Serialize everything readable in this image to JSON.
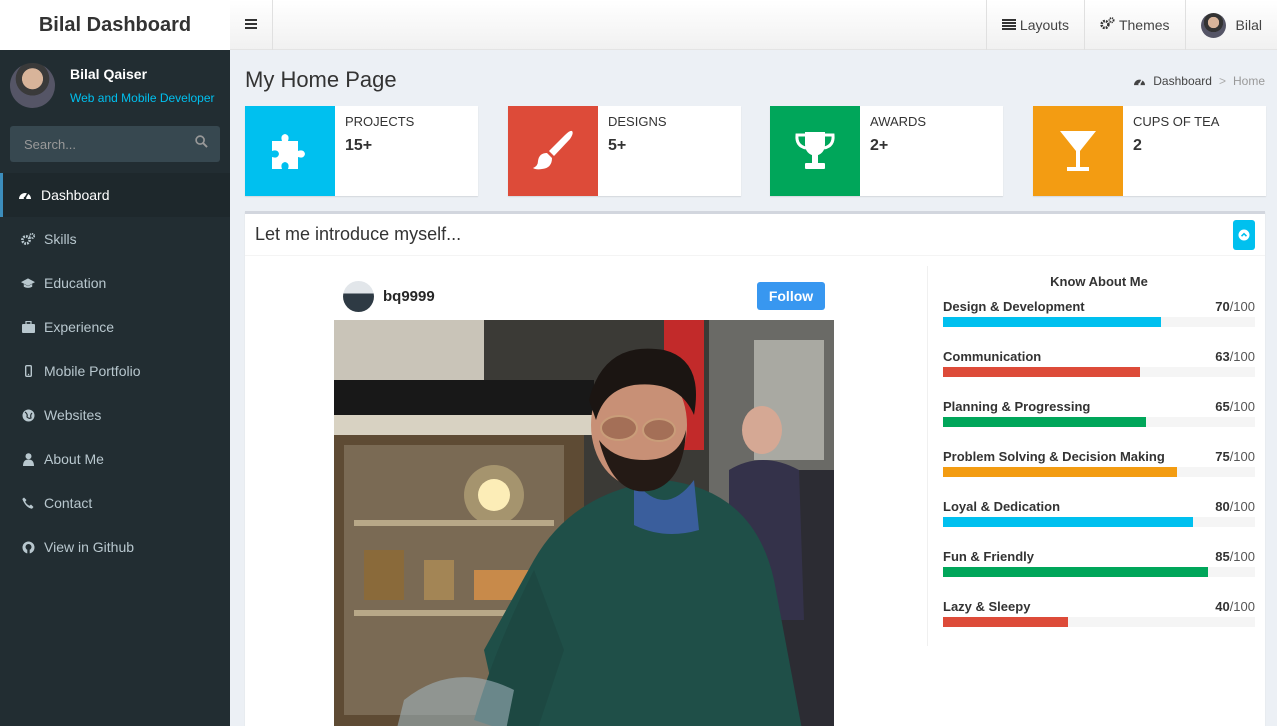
{
  "app": {
    "title": "Bilal Dashboard"
  },
  "user": {
    "name": "Bilal Qaiser",
    "role": "Web and Mobile Developer",
    "short_name": "Bilal"
  },
  "search": {
    "placeholder": "Search..."
  },
  "menu": [
    {
      "label": "Dashboard",
      "icon": "dashboard-icon",
      "active": true
    },
    {
      "label": "Skills",
      "icon": "cogs-icon"
    },
    {
      "label": "Education",
      "icon": "graduation-cap-icon"
    },
    {
      "label": "Experience",
      "icon": "briefcase-icon"
    },
    {
      "label": "Mobile Portfolio",
      "icon": "mobile-icon"
    },
    {
      "label": "Websites",
      "icon": "globe-icon"
    },
    {
      "label": "About Me",
      "icon": "user-icon"
    },
    {
      "label": "Contact",
      "icon": "phone-icon"
    },
    {
      "label": "View in Github",
      "icon": "github-icon"
    }
  ],
  "navbar": {
    "layouts": "Layouts",
    "themes": "Themes"
  },
  "page": {
    "title": "My Home Page"
  },
  "breadcrumb": {
    "home_link": "Dashboard",
    "current": "Home"
  },
  "info_boxes": [
    {
      "label": "PROJECTS",
      "value": "15+",
      "color": "#00c0ef",
      "icon": "puzzle-icon"
    },
    {
      "label": "DESIGNS",
      "value": "5+",
      "color": "#dd4b39",
      "icon": "paint-brush-icon"
    },
    {
      "label": "AWARDS",
      "value": "2+",
      "color": "#00a65a",
      "icon": "trophy-icon"
    },
    {
      "label": "CUPS OF TEA",
      "value": "2",
      "color": "#f39c12",
      "icon": "glass-icon"
    }
  ],
  "intro": {
    "title": "Let me introduce myself..."
  },
  "instagram": {
    "username": "bq9999",
    "follow_label": "Follow"
  },
  "skills": {
    "title": "Know About Me",
    "max_label": "/100",
    "items": [
      {
        "name": "Design & Development",
        "value": 70,
        "color": "#00c0ef"
      },
      {
        "name": "Communication",
        "value": 63,
        "color": "#dd4b39"
      },
      {
        "name": "Planning & Progressing",
        "value": 65,
        "color": "#00a65a"
      },
      {
        "name": "Problem Solving & Decision Making",
        "value": 75,
        "color": "#f39c12"
      },
      {
        "name": "Loyal & Dedication",
        "value": 80,
        "color": "#00c0ef"
      },
      {
        "name": "Fun & Friendly",
        "value": 85,
        "color": "#00a65a"
      },
      {
        "name": "Lazy & Sleepy",
        "value": 40,
        "color": "#dd4b39"
      }
    ]
  }
}
